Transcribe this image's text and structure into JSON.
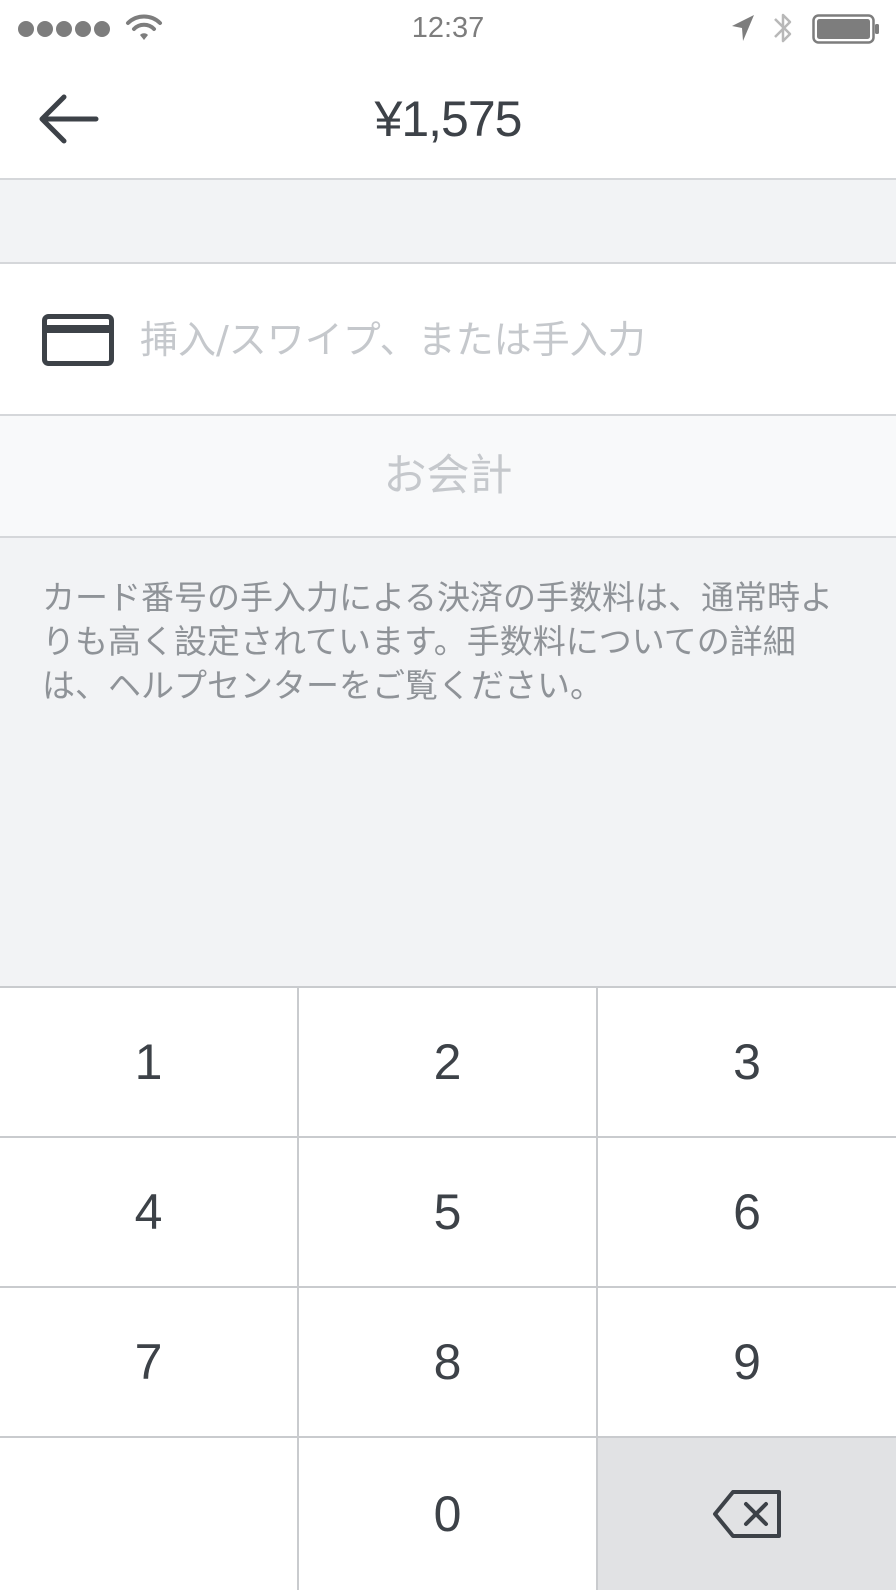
{
  "status_bar": {
    "time": "12:37",
    "signal_icon": "signal-dots-icon",
    "wifi_icon": "wifi-icon",
    "location_icon": "location-arrow-icon",
    "bluetooth_icon": "bluetooth-icon",
    "battery_icon": "battery-icon"
  },
  "nav": {
    "back_icon": "arrow-left-icon",
    "title": "¥1,575"
  },
  "card_entry": {
    "icon": "credit-card-icon",
    "placeholder": "挿入/スワイプ、または手入力",
    "value": ""
  },
  "charge_button": {
    "label": "お会計"
  },
  "notice": {
    "text": "カード番号の手入力による決済の手数料は、通常時よりも高く設定されています。手数料についての詳細は、ヘルプセンターをご覧ください。"
  },
  "keypad": {
    "keys": [
      "1",
      "2",
      "3",
      "4",
      "5",
      "6",
      "7",
      "8",
      "9",
      "",
      "0"
    ],
    "delete_icon": "backspace-icon"
  },
  "colors": {
    "text_primary": "#3d4248",
    "text_muted": "#8f9398",
    "placeholder": "#c5c8cc",
    "background_gray": "#f2f3f5",
    "divider": "#d5d7da",
    "delete_key_bg": "#e1e2e4"
  }
}
